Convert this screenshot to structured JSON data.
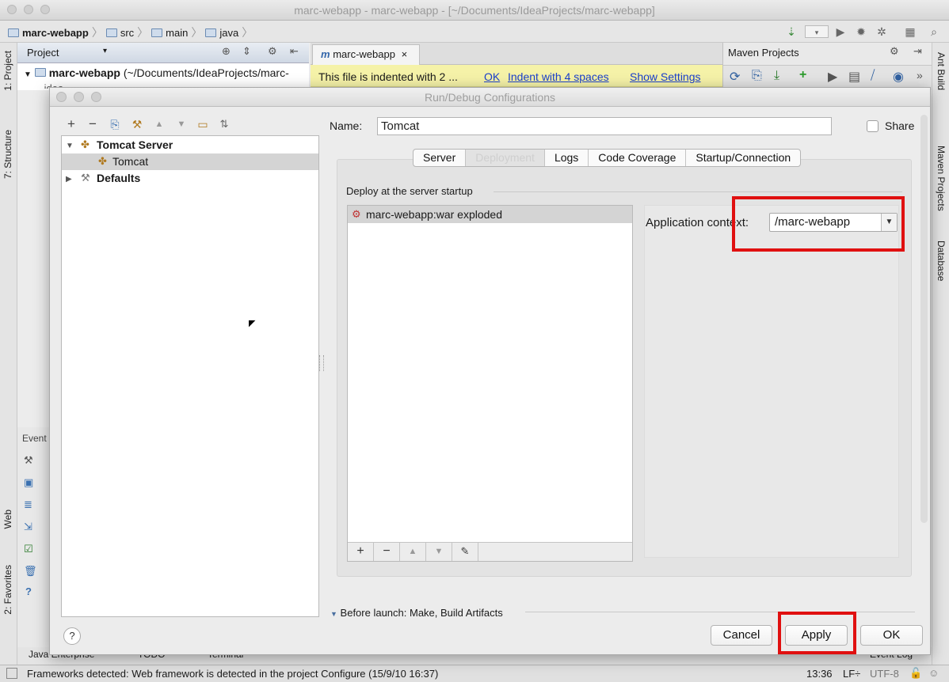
{
  "window": {
    "title": "marc-webapp - marc-webapp - [~/Documents/IdeaProjects/marc-webapp]"
  },
  "breadcrumb": [
    "marc-webapp",
    "src",
    "main",
    "java"
  ],
  "left_strip": {
    "project_tab": "1: Project",
    "structure_tab": "7: Structure",
    "web_tab": "Web",
    "favorites_tab": "2: Favorites"
  },
  "project_panel": {
    "header": "Project",
    "root_label": "marc-webapp",
    "root_path": "(~/Documents/IdeaProjects/marc-",
    "child": ".idea"
  },
  "editor": {
    "tab_label": "marc-webapp",
    "banner_text": "This file is indented with 2 ...",
    "ok_link": "OK",
    "indent_link": "Indent with 4 spaces",
    "settings_link": "Show Settings"
  },
  "maven": {
    "title": "Maven Projects"
  },
  "right_strip": {
    "ant_tab": "Ant Build",
    "maven_tab": "Maven Projects",
    "db_tab": "Database"
  },
  "events": {
    "label": "Event"
  },
  "dialog": {
    "title": "Run/Debug Configurations",
    "tree": {
      "group": "Tomcat Server",
      "item": "Tomcat",
      "defaults": "Defaults"
    },
    "name_label": "Name:",
    "name_value": "Tomcat",
    "share_label": "Share",
    "tabs": [
      "Server",
      "Deployment",
      "Logs",
      "Code Coverage",
      "Startup/Connection"
    ],
    "active_tab": "Deployment",
    "deploy_section": "Deploy at the server startup",
    "artifact": "marc-webapp:war exploded",
    "context_label": "Application context:",
    "context_value": "/marc-webapp",
    "before_launch": "Before launch: Make, Build Artifacts",
    "buttons": {
      "cancel": "Cancel",
      "apply": "Apply",
      "ok": "OK",
      "help": "?"
    }
  },
  "bottom_tools": {
    "java_enterprise": "Java Enterprise",
    "todo": "TODO",
    "terminal": "Terminal",
    "event_log": "Event Log"
  },
  "statusbar": {
    "message": "Frameworks detected: Web framework is detected in the project Configure (15/9/10 16:37)",
    "position": "13:36",
    "line_sep": "LF÷",
    "encoding": "UTF-8"
  },
  "colors": {
    "highlight": "#e01010",
    "banner": "#f5f2a8",
    "link": "#1a3fcc"
  }
}
